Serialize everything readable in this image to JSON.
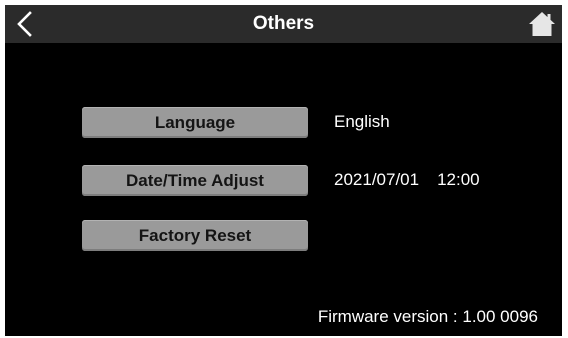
{
  "header": {
    "title": "Others",
    "back_icon": "chevron-left-icon",
    "home_icon": "home-icon"
  },
  "menu": {
    "language_label": "Language",
    "datetime_label": "Date/Time Adjust",
    "factory_reset_label": "Factory Reset"
  },
  "values": {
    "language": "English",
    "date": "2021/07/01",
    "time": "12:00"
  },
  "footer": {
    "firmware_version": "Firmware version : 1.00 0096"
  },
  "colors": {
    "background": "#000000",
    "header_bar": "#2b2b2b",
    "button_fill": "#9a9a9a",
    "button_text": "#141414",
    "text": "#ffffff"
  }
}
